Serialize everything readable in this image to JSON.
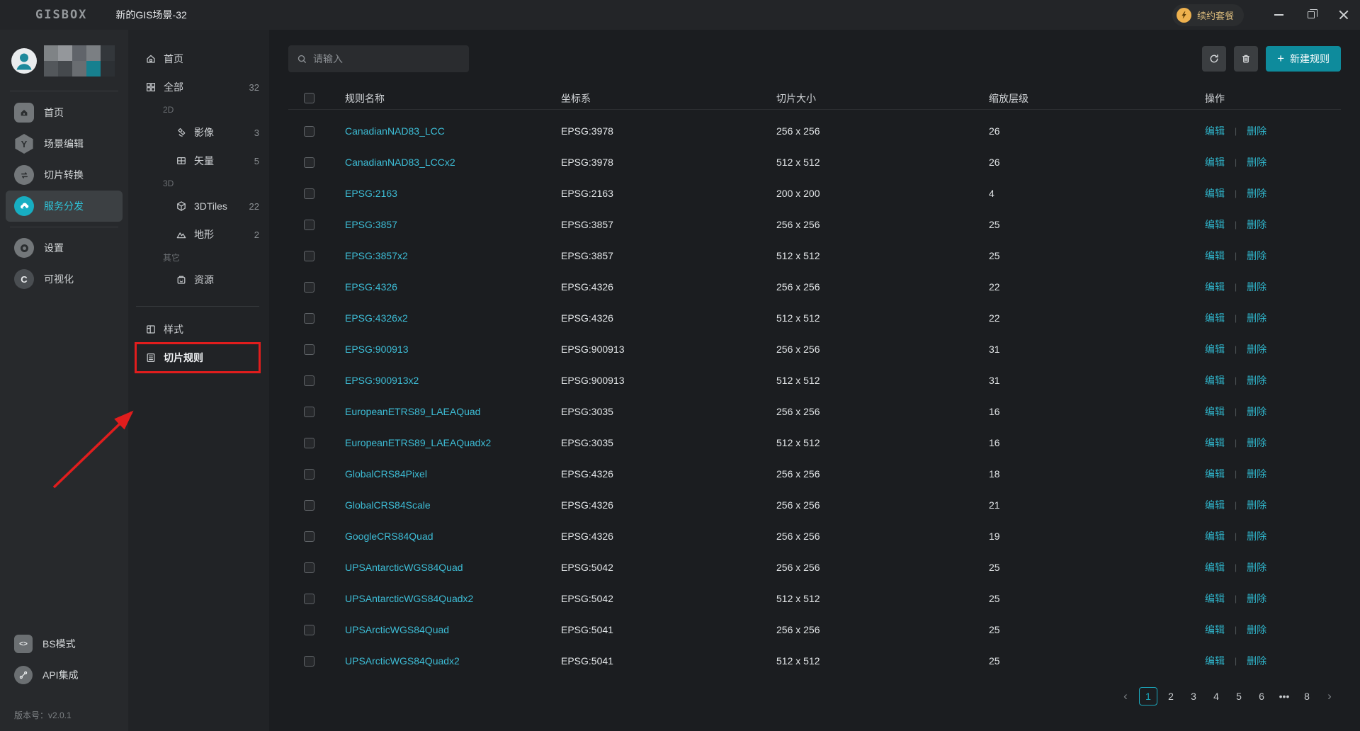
{
  "titlebar": {
    "logo": "GISBOX",
    "title": "新的GIS场景-32",
    "renew_label": "续约套餐"
  },
  "accent_colors": {
    "cyan": "#17aec2",
    "link": "#3dbdd6",
    "red_annotation": "#e11d1d",
    "gold": "#eeb14e"
  },
  "sidebar": {
    "nav": [
      {
        "label": "首页",
        "icon": "home-square-icon",
        "active": false
      },
      {
        "label": "场景编辑",
        "icon": "scene-edit-icon",
        "active": false
      },
      {
        "label": "切片转换",
        "icon": "tile-convert-icon",
        "active": false
      },
      {
        "label": "服务分发",
        "icon": "cloud-dispatch-icon",
        "active": true
      },
      {
        "label": "设置",
        "icon": "settings-gear-icon",
        "active": false
      },
      {
        "label": "可视化",
        "icon": "visualization-icon",
        "active": false
      }
    ],
    "footer": [
      {
        "label": "BS模式",
        "icon": "code-icon"
      },
      {
        "label": "API集成",
        "icon": "api-icon"
      }
    ],
    "version": "版本号：v2.0.1"
  },
  "panel": {
    "items": [
      {
        "type": "item",
        "icon": "home-icon",
        "label": "首页",
        "count": "",
        "indent": 0
      },
      {
        "type": "item",
        "icon": "grid-all-icon",
        "label": "全部",
        "count": "32",
        "indent": 0
      },
      {
        "type": "section",
        "label": "2D"
      },
      {
        "type": "item",
        "icon": "satellite-icon",
        "label": "影像",
        "count": "3",
        "indent": 1
      },
      {
        "type": "item",
        "icon": "vector-icon",
        "label": "矢量",
        "count": "5",
        "indent": 1
      },
      {
        "type": "section",
        "label": "3D"
      },
      {
        "type": "item",
        "icon": "cube-icon",
        "label": "3DTiles",
        "count": "22",
        "indent": 1
      },
      {
        "type": "item",
        "icon": "terrain-icon",
        "label": "地形",
        "count": "2",
        "indent": 1
      },
      {
        "type": "section",
        "label": "其它"
      },
      {
        "type": "item",
        "icon": "resource-icon",
        "label": "资源",
        "count": "",
        "indent": 1
      },
      {
        "type": "divider"
      },
      {
        "type": "item",
        "icon": "style-icon",
        "label": "样式",
        "count": "",
        "indent": 0
      },
      {
        "type": "item",
        "icon": "rule-icon",
        "label": "切片规则",
        "count": "",
        "indent": 0,
        "highlighted": true
      }
    ]
  },
  "toolbar": {
    "search_placeholder": "请输入",
    "new_rule_label": "新建规则",
    "plus_glyph": "+"
  },
  "table": {
    "headers": [
      "规则名称",
      "坐标系",
      "切片大小",
      "缩放层级",
      "操作"
    ],
    "edit_label": "编辑",
    "delete_label": "删除",
    "op_divider": "|",
    "rows": [
      {
        "name": "CanadianNAD83_LCC",
        "crs": "EPSG:3978",
        "size": "256 x 256",
        "level": "26"
      },
      {
        "name": "CanadianNAD83_LCCx2",
        "crs": "EPSG:3978",
        "size": "512 x 512",
        "level": "26"
      },
      {
        "name": "EPSG:2163",
        "crs": "EPSG:2163",
        "size": "200 x 200",
        "level": "4"
      },
      {
        "name": "EPSG:3857",
        "crs": "EPSG:3857",
        "size": "256 x 256",
        "level": "25"
      },
      {
        "name": "EPSG:3857x2",
        "crs": "EPSG:3857",
        "size": "512 x 512",
        "level": "25"
      },
      {
        "name": "EPSG:4326",
        "crs": "EPSG:4326",
        "size": "256 x 256",
        "level": "22"
      },
      {
        "name": "EPSG:4326x2",
        "crs": "EPSG:4326",
        "size": "512 x 512",
        "level": "22"
      },
      {
        "name": "EPSG:900913",
        "crs": "EPSG:900913",
        "size": "256 x 256",
        "level": "31"
      },
      {
        "name": "EPSG:900913x2",
        "crs": "EPSG:900913",
        "size": "512 x 512",
        "level": "31"
      },
      {
        "name": "EuropeanETRS89_LAEAQuad",
        "crs": "EPSG:3035",
        "size": "256 x 256",
        "level": "16"
      },
      {
        "name": "EuropeanETRS89_LAEAQuadx2",
        "crs": "EPSG:3035",
        "size": "512 x 512",
        "level": "16"
      },
      {
        "name": "GlobalCRS84Pixel",
        "crs": "EPSG:4326",
        "size": "256 x 256",
        "level": "18"
      },
      {
        "name": "GlobalCRS84Scale",
        "crs": "EPSG:4326",
        "size": "256 x 256",
        "level": "21"
      },
      {
        "name": "GoogleCRS84Quad",
        "crs": "EPSG:4326",
        "size": "256 x 256",
        "level": "19"
      },
      {
        "name": "UPSAntarcticWGS84Quad",
        "crs": "EPSG:5042",
        "size": "256 x 256",
        "level": "25"
      },
      {
        "name": "UPSAntarcticWGS84Quadx2",
        "crs": "EPSG:5042",
        "size": "512 x 512",
        "level": "25"
      },
      {
        "name": "UPSArcticWGS84Quad",
        "crs": "EPSG:5041",
        "size": "256 x 256",
        "level": "25"
      },
      {
        "name": "UPSArcticWGS84Quadx2",
        "crs": "EPSG:5041",
        "size": "512 x 512",
        "level": "25"
      }
    ]
  },
  "pagination": {
    "prev": "‹",
    "next": "›",
    "pages": [
      "1",
      "2",
      "3",
      "4",
      "5",
      "6",
      "•••",
      "8"
    ],
    "current": "1"
  }
}
